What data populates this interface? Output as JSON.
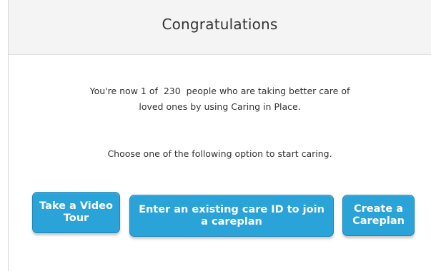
{
  "dialog": {
    "title": "Congratulations",
    "message_line1": "You're now 1 of  230  people who are taking better care of",
    "message_line2": "loved ones by using Caring in Place.",
    "prompt": "Choose one of the following option to start caring."
  },
  "buttons": {
    "video_tour": "Take a Video Tour",
    "join_careplan": "Enter an existing care ID to join a careplan",
    "create_careplan": "Create a Careplan"
  },
  "colors": {
    "button_bg": "#2aa3d8",
    "header_bg": "#f4f4f4"
  }
}
